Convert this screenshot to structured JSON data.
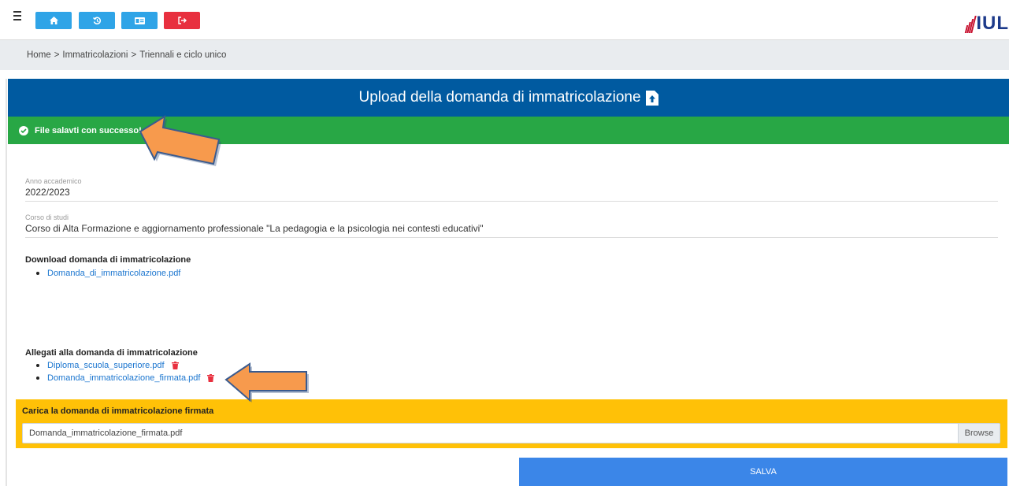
{
  "topbar": {
    "icons": {
      "menu": "hamburger-icon",
      "home": "home-icon",
      "history": "history-icon",
      "card": "id-card-icon",
      "logout": "logout-icon"
    },
    "logo_text": "IUL"
  },
  "breadcrumb": {
    "items": [
      "Home",
      "Immatricolazioni",
      "Triennali e ciclo unico"
    ],
    "separator": ">"
  },
  "page": {
    "title": "Upload della domanda di immatricolazione"
  },
  "alert": {
    "message": "File salavti con successo!"
  },
  "fields": {
    "anno": {
      "label": "Anno accademico",
      "value": "2022/2023"
    },
    "corso": {
      "label": "Corso di studi",
      "value": "Corso di Alta Formazione e aggiornamento professionale \"La pedagogia e la psicologia nei contesti educativi\""
    }
  },
  "download": {
    "title": "Download domanda di immatricolazione",
    "files": [
      "Domanda_di_immatricolazione.pdf"
    ]
  },
  "allegati": {
    "title": "Allegati alla domanda di immatricolazione",
    "files": [
      "Diploma_scuola_superiore.pdf",
      "Domanda_immatricolazione_firmata.pdf"
    ]
  },
  "upload": {
    "title": "Carica la domanda di immatricolazione firmata",
    "file_value": "Domanda_immatricolazione_firmata.pdf",
    "browse_label": "Browse"
  },
  "actions": {
    "save_label": "SALVA"
  },
  "colors": {
    "title_bar": "#005aa0",
    "success": "#28a745",
    "upload_panel": "#ffc107",
    "save": "#3b86e8",
    "nav_blue": "#2fa4e7",
    "nav_red": "#e8303f",
    "annotation_arrow": "#f79a4d"
  }
}
